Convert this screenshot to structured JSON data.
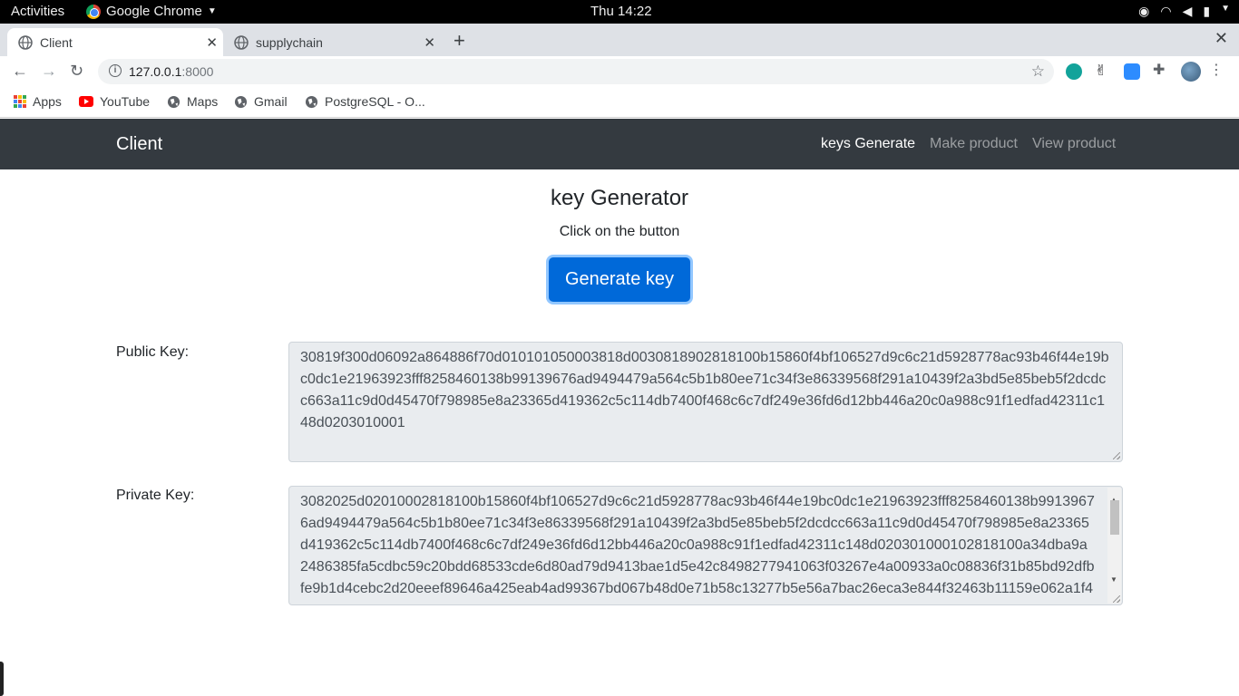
{
  "system_bar": {
    "activities": "Activities",
    "app_name": "Google Chrome",
    "clock": "Thu 14:22",
    "tray_icons": [
      "location-icon",
      "wifi-icon",
      "volume-icon",
      "battery-icon"
    ]
  },
  "tabs": [
    {
      "title": "Client",
      "active": true
    },
    {
      "title": "supplychain",
      "active": false
    }
  ],
  "address_bar": {
    "host": "127.0.0.1",
    "port": ":8000"
  },
  "bookmarks": [
    {
      "label": "Apps",
      "icon": "apps-grid-icon"
    },
    {
      "label": "YouTube",
      "icon": "youtube-icon"
    },
    {
      "label": "Maps",
      "icon": "globe-icon"
    },
    {
      "label": "Gmail",
      "icon": "globe-icon"
    },
    {
      "label": "PostgreSQL - O...",
      "icon": "globe-icon"
    }
  ],
  "navbar": {
    "brand": "Client",
    "links": [
      {
        "label": "keys Generate",
        "active": true
      },
      {
        "label": "Make product",
        "active": false
      },
      {
        "label": "View product",
        "active": false
      }
    ]
  },
  "main": {
    "heading": "key Generator",
    "subheading": "Click on the button",
    "button_label": "Generate key",
    "public_key_label": "Public Key:",
    "public_key": "30819f300d06092a864886f70d010101050003818d0030818902818100b15860f4bf106527d9c6c21d5928778ac93b46f44e19bc0dc1e21963923fff8258460138b99139676ad9494479a564c5b1b80ee71c34f3e86339568f291a10439f2a3bd5e85beb5f2dcdcc663a11c9d0d45470f798985e8a23365d419362c5c114db7400f468c6c7df249e36fd6d12bb446a20c0a988c91f1edfad42311c148d0203010001",
    "private_key_label": "Private Key:",
    "private_key": "3082025d02010002818100b15860f4bf106527d9c6c21d5928778ac93b46f44e19bc0dc1e21963923fff8258460138b99139676ad9494479a564c5b1b80ee71c34f3e86339568f291a10439f2a3bd5e85beb5f2dcdcc663a11c9d0d45470f798985e8a23365d419362c5c114db7400f468c6c7df249e36fd6d12bb446a20c0a988c91f1edfad42311c148d020301000102818100a34dba9a2486385fa5cdbc59c20bdd68533cde6d80ad79d9413bae1d5e42c8498277941063f03267e4a00933a0c08836f31b85bd92dfbfe9b1d4cebc2d20eeef89646a425eab4ad99367bd067b48d0e71b58c13277b5e56a7bac26eca3e844f32463b11159e062a1f4"
  },
  "colors": {
    "navbar_bg": "#343a40",
    "primary": "#0069d9",
    "textarea_bg": "#e9ecef"
  }
}
